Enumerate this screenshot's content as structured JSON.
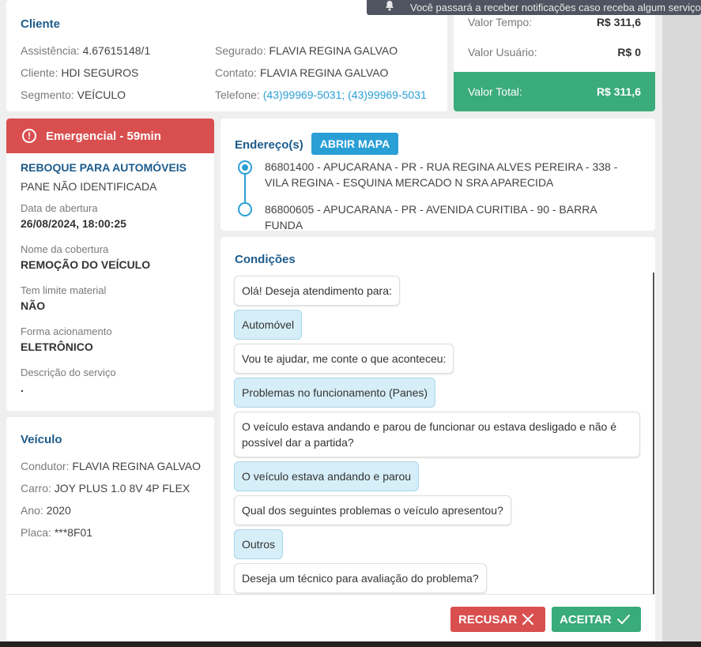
{
  "toast": {
    "text": "Você passará a receber notificações caso receba algum serviço"
  },
  "client": {
    "title": "Cliente",
    "left": [
      {
        "label": "Assistência:",
        "value": "4.67615148/1"
      },
      {
        "label": "Cliente:",
        "value": "HDI SEGUROS"
      },
      {
        "label": "Segmento:",
        "value": "VEÍCULO"
      }
    ],
    "right": [
      {
        "label": "Segurado:",
        "value": "FLAVIA REGINA GALVAO"
      },
      {
        "label": "Contato:",
        "value": "FLAVIA REGINA GALVAO"
      },
      {
        "label": "Telefone:",
        "value": "(43)99969-5031; (43)99969-5031"
      }
    ]
  },
  "values": {
    "time_label": "Valor Tempo:",
    "time_value": "R$ 311,6",
    "user_label": "Valor Usuário:",
    "user_value": "R$ 0",
    "total_label": "Valor Total:",
    "total_value": "R$ 311,6",
    "total_color": "#3aab7a"
  },
  "service": {
    "emergency_label": "Emergencial - 59min",
    "emergency_color": "#d94f4f",
    "info_icon": "info-icon",
    "title": "REBOQUE PARA AUTOMÓVEIS",
    "subtitle": "PANE NÃO IDENTIFICADA",
    "fields": [
      {
        "label": "Data de abertura",
        "value": "26/08/2024, 18:00:25"
      },
      {
        "label": "Nome da cobertura",
        "value": "REMOÇÃO DO VEÍCULO"
      },
      {
        "label": "Tem limite material",
        "value": "NÃO"
      },
      {
        "label": "Forma acionamento",
        "value": "ELETRÔNICO"
      },
      {
        "label": "Descrição do serviço",
        "value": "."
      }
    ]
  },
  "vehicle": {
    "title": "Veículo",
    "items": [
      {
        "label": "Condutor:",
        "value": "FLAVIA REGINA GALVAO"
      },
      {
        "label": "Carro:",
        "value": "JOY PLUS 1.0 8V 4P FLEX"
      },
      {
        "label": "Ano:",
        "value": "2020"
      },
      {
        "label": "Placa:",
        "value": "***8F01"
      }
    ]
  },
  "address": {
    "title": "Endereço(s)",
    "map_button": "ABRIR MAPA",
    "items": [
      "86801400 - APUCARANA - PR - RUA REGINA ALVES PEREIRA - 338 - VILA REGINA - ESQUINA MERCADO N SRA APARECIDA",
      "86800605 - APUCARANA - PR - AVENIDA CURITIBA - 90 - BARRA FUNDA"
    ]
  },
  "conditions": {
    "title": "Condições",
    "messages": [
      {
        "type": "question",
        "text": "Olá! Deseja atendimento para:"
      },
      {
        "type": "answer",
        "text": "Automóvel"
      },
      {
        "type": "question",
        "text": "Vou te ajudar, me conte o que aconteceu:"
      },
      {
        "type": "answer",
        "text": "Problemas no funcionamento (Panes)"
      },
      {
        "type": "question",
        "text": "O veículo estava andando e parou de funcionar ou estava desligado e não é possível dar a partida?"
      },
      {
        "type": "answer",
        "text": "O veículo estava andando e parou"
      },
      {
        "type": "question",
        "text": "Qual dos seguintes problemas o veículo apresentou?"
      },
      {
        "type": "answer",
        "text": "Outros"
      },
      {
        "type": "question",
        "text": "Deseja um técnico para avaliação do problema?"
      }
    ]
  },
  "footer": {
    "refuse_label": "RECUSAR",
    "refuse_icon": "close-icon",
    "refuse_color": "#d94f4f",
    "accept_label": "ACEITAR",
    "accept_icon": "check-icon",
    "accept_color": "#3aab7a"
  }
}
